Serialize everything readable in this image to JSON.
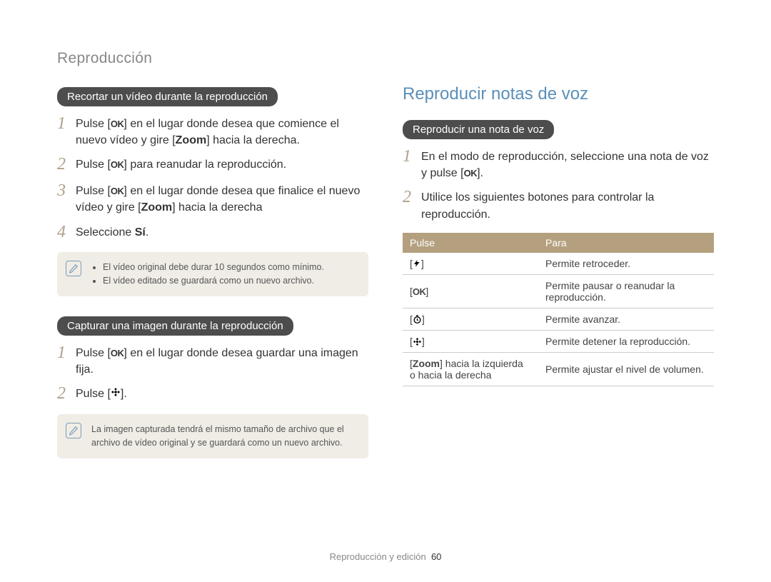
{
  "header": "Reproducción",
  "left": {
    "section1": {
      "pill": "Recortar un vídeo durante la reproducción",
      "steps": [
        {
          "pre": "Pulse [",
          "icon": "OK",
          "post": "] en el lugar donde desea que comience el nuevo vídeo y gire [",
          "bold": "Zoom",
          "tail": "] hacia la derecha."
        },
        {
          "pre": "Pulse [",
          "icon": "OK",
          "post": "] para reanudar la reproducción."
        },
        {
          "pre": "Pulse [",
          "icon": "OK",
          "post": "] en el lugar donde desea que finalice el nuevo vídeo y gire [",
          "bold": "Zoom",
          "tail": "] hacia la derecha"
        },
        {
          "pre": "Seleccione ",
          "bold": "Sí",
          "tail": "."
        }
      ],
      "notes": [
        "El vídeo original debe durar 10 segundos como mínimo.",
        "El vídeo editado se guardará como un nuevo archivo."
      ]
    },
    "section2": {
      "pill": "Capturar una imagen durante la reproducción",
      "steps": [
        {
          "pre": "Pulse [",
          "icon": "OK",
          "post": "] en el lugar donde desea guardar una imagen fija."
        },
        {
          "pre": "Pulse  [",
          "iconSvg": "flower",
          "post": "]."
        }
      ],
      "note": "La imagen capturada tendrá el mismo tamaño de archivo que el archivo de vídeo original y se guardará como un nuevo archivo."
    }
  },
  "right": {
    "title": "Reproducir notas de voz",
    "pill": "Reproducir una nota de voz",
    "steps": [
      {
        "pre": "En el modo de reproducción, seleccione una nota de voz y pulse [",
        "icon": "OK",
        "post": "]."
      },
      {
        "pre": "Utilice los siguientes botones para controlar la reproducción."
      }
    ],
    "table": {
      "head": {
        "c1": "Pulse",
        "c2": "Para"
      },
      "rows": [
        {
          "icon": "flash",
          "text": "Permite retroceder."
        },
        {
          "icon": "OK",
          "text": "Permite pausar o reanudar la reproducción."
        },
        {
          "icon": "timer",
          "text": "Permite avanzar."
        },
        {
          "icon": "flower",
          "text": "Permite detener la reproducción."
        },
        {
          "raw_pre": "[",
          "bold": "Zoom",
          "raw_post": "] hacia la izquierda o hacia la derecha",
          "text": "Permite ajustar el nivel de volumen."
        }
      ]
    }
  },
  "footer": {
    "label": "Reproducción y edición",
    "page": "60"
  }
}
